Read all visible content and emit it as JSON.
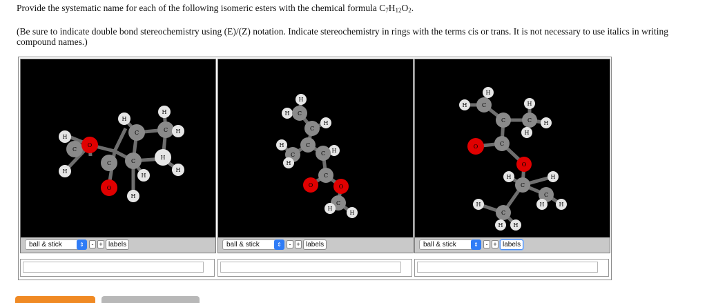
{
  "question": {
    "prompt_text": "Provide the systematic name for each of the following isomeric esters with the chemical formula C",
    "formula_sub_c": "7",
    "formula_h": "H",
    "formula_sub_h": "12",
    "formula_o": "O",
    "formula_sub_o": "2",
    "formula_end": ".",
    "instructions": "(Be sure to indicate double bond stereochemistry using (E)/(Z) notation. Indicate stereochemistry in rings with the terms cis or trans. It is not necessary to use italics in writing compound names.)"
  },
  "viewers": [
    {
      "render_mode": "ball & stick",
      "minus": "-",
      "plus": "+",
      "labels_button": "labels",
      "answer_value": ""
    },
    {
      "render_mode": "ball & stick",
      "minus": "-",
      "plus": "+",
      "labels_button": "labels",
      "answer_value": ""
    },
    {
      "render_mode": "ball & stick",
      "minus": "-",
      "plus": "+",
      "labels_button": "labels",
      "answer_value": ""
    }
  ],
  "atom_labels": {
    "carbon": "C",
    "hydrogen": "H",
    "oxygen": "O"
  },
  "colors": {
    "carbon": "#8a8a8a",
    "hydrogen": "#e6e6e6",
    "oxygen": "#e00000",
    "viewer_bg": "#000000",
    "accent": "#f08a24",
    "select_blue": "#2f7cf6"
  }
}
